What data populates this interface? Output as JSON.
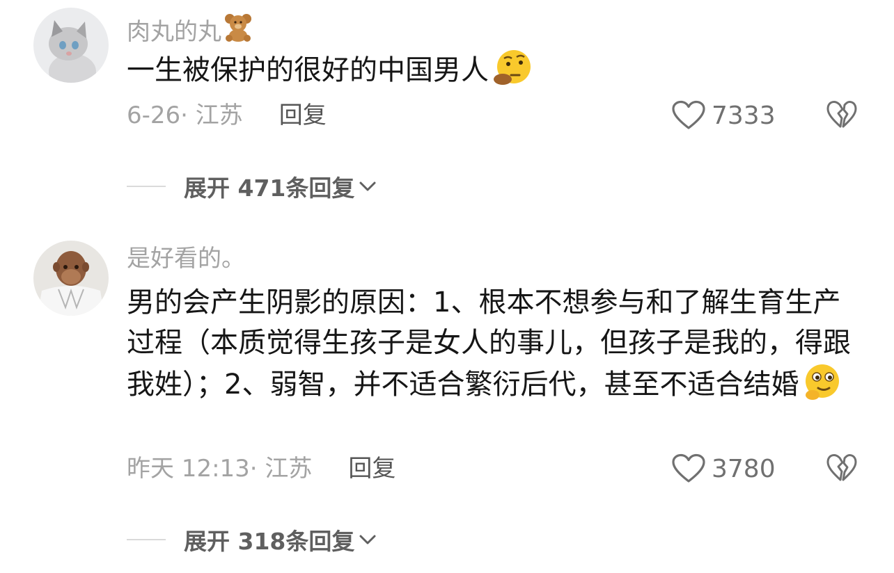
{
  "comments": [
    {
      "username": "肉丸的丸",
      "username_emoji": "teddy-bear",
      "text": "一生被保护的很好的中国男人",
      "text_emoji": "thinking-face",
      "time_location": "6-26· 江苏",
      "reply_label": "回复",
      "likes": "7333",
      "expand_label": "展开 471条回复"
    },
    {
      "username": "是好看的。",
      "text": "男的会产生阴影的原因：1、根本不想参与和了解生育生产过程（本质觉得生孩子是女人的事儿，但孩子是我的，得跟我姓）；2、弱智，并不适合繁衍后代，甚至不适合结婚",
      "text_emoji": "thinking-face",
      "time_location": "昨天 12:13· 江苏",
      "reply_label": "回复",
      "likes": "3780",
      "expand_label": "展开 318条回复"
    }
  ],
  "colors": {
    "secondary_text": "#a3a3a3",
    "primary_text": "#161616",
    "icon": "#707070"
  }
}
